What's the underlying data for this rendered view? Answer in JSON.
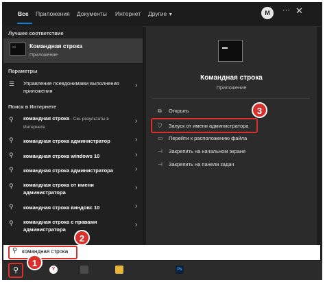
{
  "tabs": {
    "all": "Все",
    "apps": "Приложения",
    "documents": "Документы",
    "internet": "Интернет",
    "other": "Другие",
    "avatar": "M",
    "more": "···",
    "close": "✕"
  },
  "left": {
    "best_match_header": "Лучшее соответствие",
    "best_match_title": "Командная строка",
    "best_match_subtitle": "Приложение",
    "settings_header": "Параметры",
    "settings_item": "Управление псевдонимами выполнения приложения",
    "web_header": "Поиск в Интернете",
    "web_items": [
      {
        "text": "командная строка",
        "hint": " - См. результаты в Интернете"
      },
      {
        "text": "командная строка администратор",
        "hint": ""
      },
      {
        "text": "командная строка windows 10",
        "hint": ""
      },
      {
        "text": "командная строка администратора",
        "hint": ""
      },
      {
        "text": "командная строка от имени администратора",
        "hint": ""
      },
      {
        "text": "командная строка виндовс 10",
        "hint": ""
      },
      {
        "text": "командная строка с правами администратора",
        "hint": ""
      }
    ]
  },
  "right": {
    "title": "Командная строка",
    "subtitle": "Приложение",
    "actions": [
      "Открыть",
      "Запуск от имени администратора",
      "Перейти к расположению файла",
      "Закрепить на начальном экране",
      "Закрепить на панели задач"
    ]
  },
  "search": {
    "value": "командная строка"
  },
  "badges": [
    "1",
    "2",
    "3"
  ],
  "taskbar": {
    "yandex": "Y",
    "photoshop": "Ps"
  },
  "colors": {
    "accent_blue": "#0a84d8",
    "highlight_red": "#d8302c",
    "panel_dark": "#202020",
    "panel_right": "#2b2b2b"
  }
}
